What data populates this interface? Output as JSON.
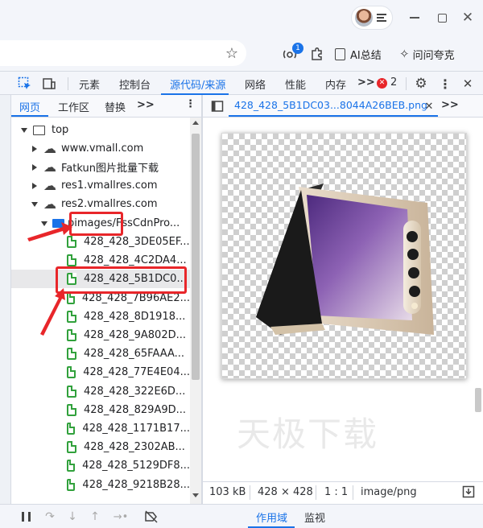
{
  "browser": {
    "toolbar": {
      "ai_summary_label": "AI总结",
      "ask_label": "问问夸克"
    },
    "badge_count": "1"
  },
  "devtools": {
    "main_tabs": [
      "元素",
      "控制台",
      "源代码/来源",
      "网络",
      "性能",
      "内存"
    ],
    "active_main_tab": "源代码/来源",
    "error_count": "2",
    "more_tabs_label": ">>",
    "left_tabs": [
      "网页",
      "工作区",
      "替换"
    ],
    "file_tree": {
      "root": "top",
      "origins": [
        "www.vmall.com",
        "Fatkun图片批量下载",
        "res1.vmallres.com",
        "res2.vmallres.com"
      ],
      "folder": "pimages/FssCdnPro...",
      "files": [
        "428_428_3DE05EF...",
        "428_428_4C2DA4...",
        "428_428_5B1DC0...",
        "428_428_7B96AE2...",
        "428_428_8D1918...",
        "428_428_9A802D...",
        "428_428_65FAAA...",
        "428_428_77E4E04...",
        "428_428_322E6D...",
        "428_428_829A9D...",
        "428_428_1171B17...",
        "428_428_2302AB...",
        "428_428_5129DF8...",
        "428_428_9218B28..."
      ],
      "selected_index": 2
    },
    "open_file_tab": "428_428_5B1DC03...8044A26BEB.png",
    "preview": {
      "size": "103 kB",
      "dimensions": "428 × 428",
      "ratio": "1 : 1",
      "mime": "image/png"
    },
    "watermark": "天极下载",
    "bottom_tabs": [
      "作用域",
      "监视"
    ],
    "active_bottom_tab": "作用域"
  },
  "colors": {
    "accent": "#1a73e8",
    "annotation_red": "#e8262a",
    "file_icon_green": "#31a13c"
  }
}
